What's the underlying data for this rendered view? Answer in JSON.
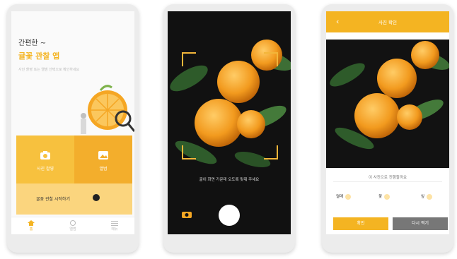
{
  "phone1": {
    "hero_title": "간편한 ~",
    "hero_accent": "귤꽃 관찰 앱",
    "hero_subtitle": "사진 촬영 또는 앨범 선택으로 확인하세요",
    "camera_button": "사진 촬영",
    "album_button": "앨범",
    "info_bar": "귤꽃 관찰 시작하기",
    "nav": [
      {
        "label": "홈",
        "icon": "home-icon"
      },
      {
        "label": "앨범",
        "icon": "clock-icon"
      },
      {
        "label": "메뉴",
        "icon": "menu-icon"
      }
    ]
  },
  "phone2": {
    "guide_text": "귤이 화면 가운데 오도록 맞춰 주세요"
  },
  "phone3": {
    "header_title": "사진 확인",
    "back_label": "‹",
    "prompt": "이 사진으로 진행할까요",
    "options": [
      "열매",
      "꽃",
      "잎"
    ],
    "confirm_button": "확인",
    "retake_button": "다시 찍기"
  },
  "colors": {
    "accent": "#f4b422",
    "accent_light": "#fbd57e",
    "bracket": "#f3b63a",
    "gray_button": "#777777"
  }
}
